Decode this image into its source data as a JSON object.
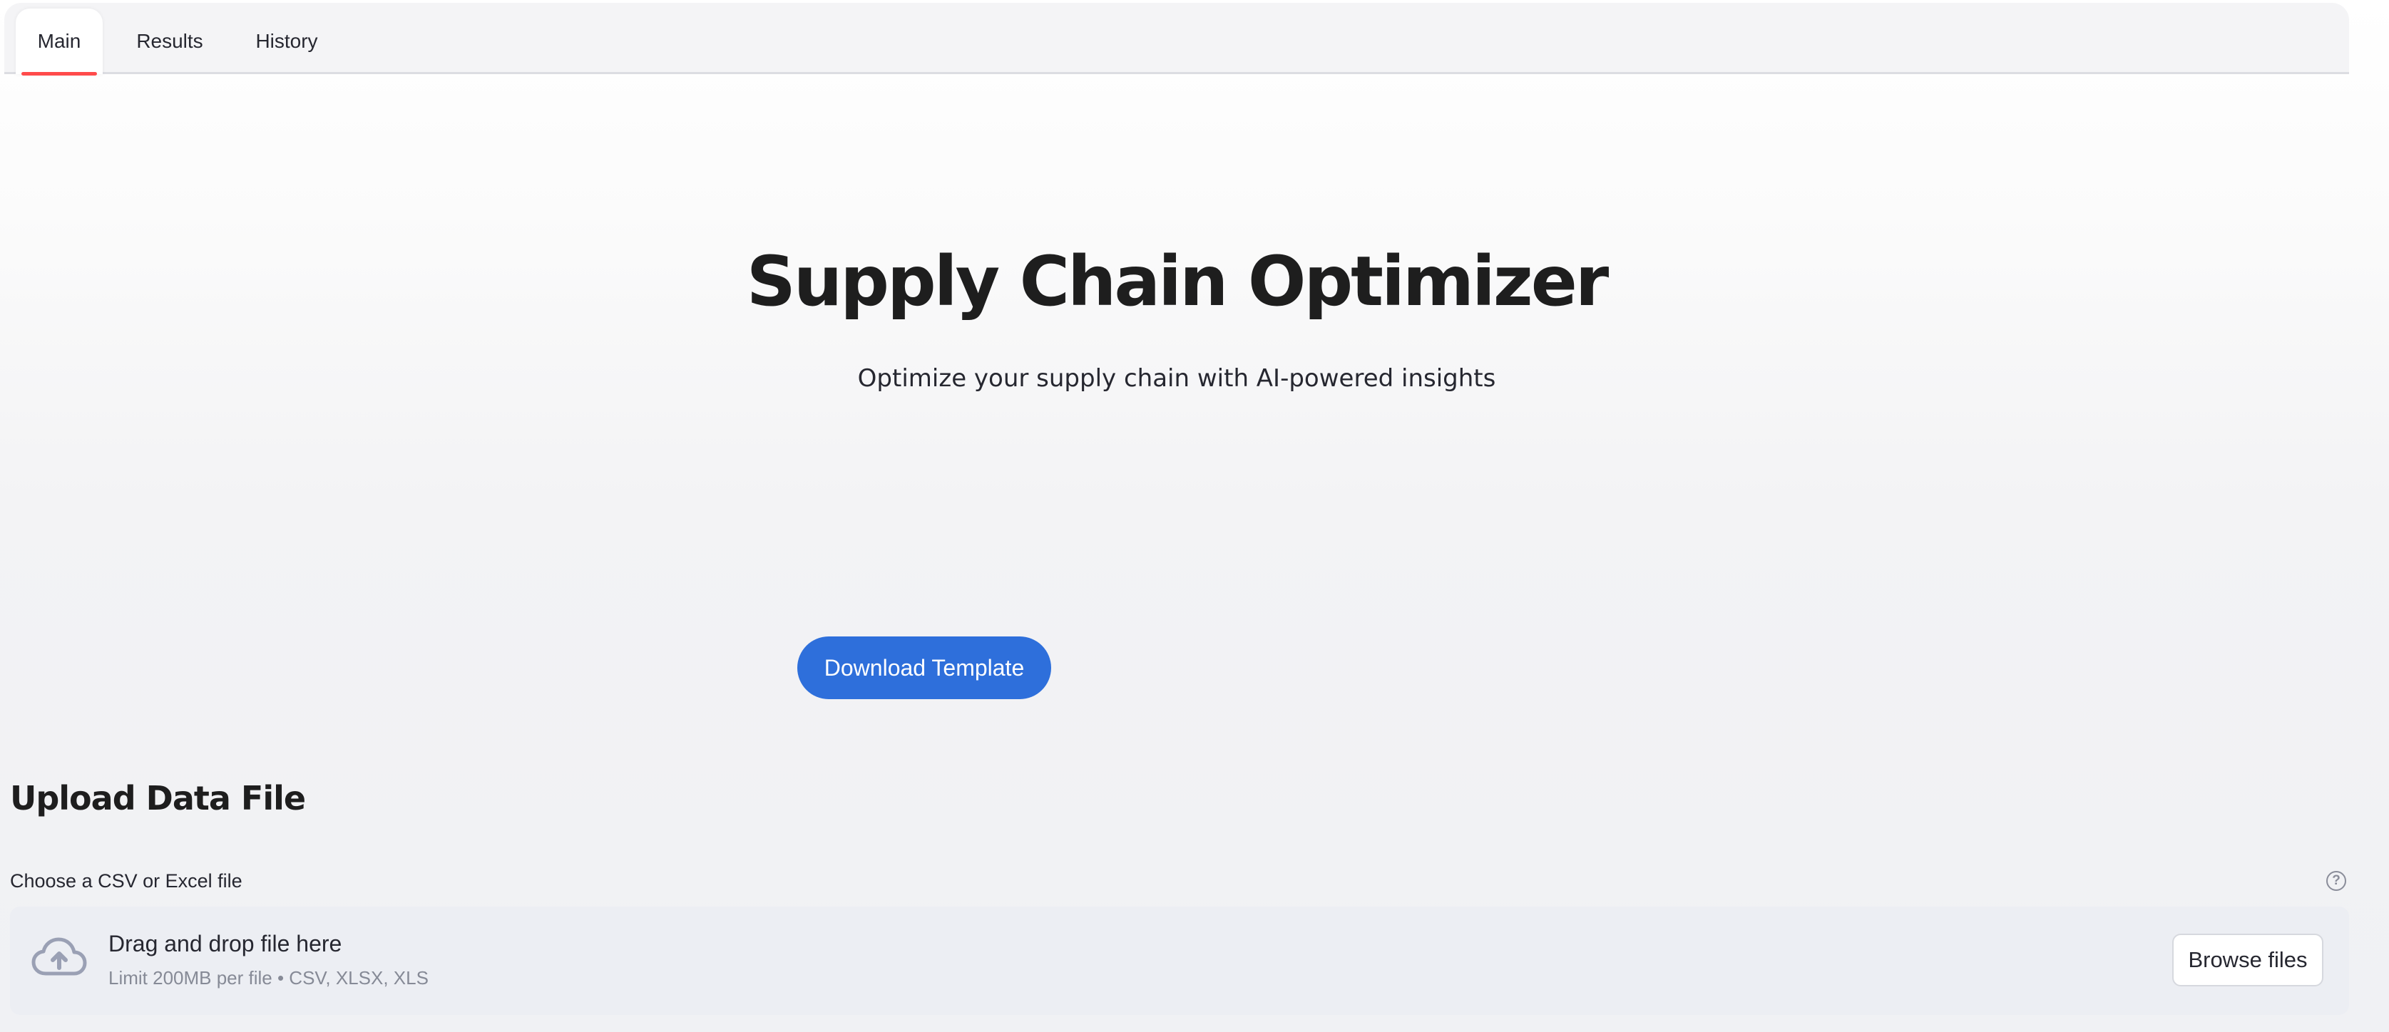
{
  "tabs": [
    {
      "label": "Main",
      "active": true
    },
    {
      "label": "Results",
      "active": false
    },
    {
      "label": "History",
      "active": false
    }
  ],
  "hero": {
    "title": "Supply Chain Optimizer",
    "subtitle": "Optimize your supply chain with AI-powered insights"
  },
  "actions": {
    "download_label": "Download Template"
  },
  "upload": {
    "heading": "Upload Data File",
    "label": "Choose a CSV or Excel file",
    "help_glyph": "?",
    "dropzone_title": "Drag and drop file here",
    "dropzone_hint": "Limit 200MB per file • CSV, XLSX, XLS",
    "browse_label": "Browse files",
    "icon": "cloud-upload-icon"
  },
  "colors": {
    "accent": "#ff4b4b",
    "primary_button": "#2e6fdb",
    "background": "#f1f2f5"
  }
}
